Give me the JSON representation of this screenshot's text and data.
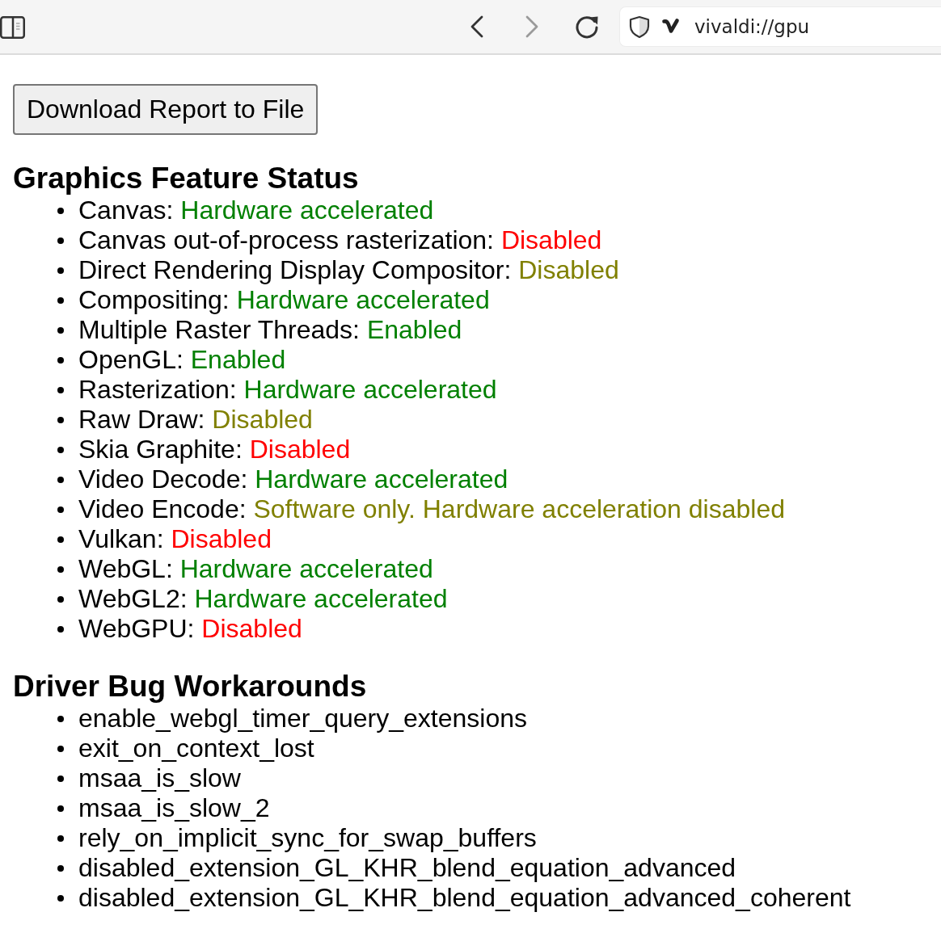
{
  "toolbar": {
    "back_button": {
      "disabled": false
    },
    "forward_button": {
      "disabled": true
    },
    "address": {
      "value": "vivaldi://gpu"
    }
  },
  "download_button": "Download Report to File",
  "feature_status": {
    "title": "Graphics Feature Status",
    "items": [
      {
        "name": "Canvas:",
        "status": "Hardware accelerated",
        "color": "#008000"
      },
      {
        "name": "Canvas out-of-process rasterization:",
        "status": "Disabled",
        "color": "#ff0000"
      },
      {
        "name": "Direct Rendering Display Compositor:",
        "status": "Disabled",
        "color": "#808000"
      },
      {
        "name": "Compositing:",
        "status": "Hardware accelerated",
        "color": "#008000"
      },
      {
        "name": "Multiple Raster Threads:",
        "status": "Enabled",
        "color": "#008000"
      },
      {
        "name": "OpenGL:",
        "status": "Enabled",
        "color": "#008000"
      },
      {
        "name": "Rasterization:",
        "status": "Hardware accelerated",
        "color": "#008000"
      },
      {
        "name": "Raw Draw:",
        "status": "Disabled",
        "color": "#808000"
      },
      {
        "name": "Skia Graphite:",
        "status": "Disabled",
        "color": "#ff0000"
      },
      {
        "name": "Video Decode:",
        "status": "Hardware accelerated",
        "color": "#008000"
      },
      {
        "name": "Video Encode:",
        "status": "Software only. Hardware acceleration disabled",
        "color": "#808000"
      },
      {
        "name": "Vulkan:",
        "status": "Disabled",
        "color": "#ff0000"
      },
      {
        "name": "WebGL:",
        "status": "Hardware accelerated",
        "color": "#008000"
      },
      {
        "name": "WebGL2:",
        "status": "Hardware accelerated",
        "color": "#008000"
      },
      {
        "name": "WebGPU:",
        "status": "Disabled",
        "color": "#ff0000"
      }
    ]
  },
  "driver_bug_workarounds": {
    "title": "Driver Bug Workarounds",
    "items": [
      "enable_webgl_timer_query_extensions",
      "exit_on_context_lost",
      "msaa_is_slow",
      "msaa_is_slow_2",
      "rely_on_implicit_sync_for_swap_buffers",
      "disabled_extension_GL_KHR_blend_equation_advanced",
      "disabled_extension_GL_KHR_blend_equation_advanced_coherent"
    ]
  }
}
